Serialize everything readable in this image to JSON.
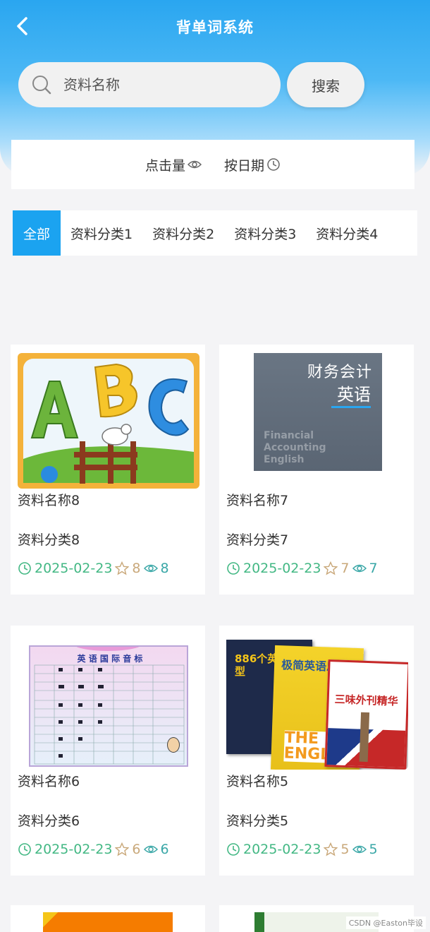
{
  "header": {
    "title": "背单词系统"
  },
  "search": {
    "placeholder": "资料名称",
    "button_label": "搜索"
  },
  "sort": {
    "by_clicks": "点击量",
    "by_date": "按日期"
  },
  "tabs": [
    {
      "label": "全部",
      "active": true
    },
    {
      "label": "资料分类1"
    },
    {
      "label": "资料分类2"
    },
    {
      "label": "资料分类3"
    },
    {
      "label": "资料分类4"
    }
  ],
  "items": [
    {
      "name": "资料名称8",
      "category": "资料分类8",
      "date": "2025-02-23",
      "likes": "8",
      "views": "8",
      "image": "abc-letters"
    },
    {
      "name": "资料名称7",
      "category": "资料分类7",
      "date": "2025-02-23",
      "likes": "7",
      "views": "7",
      "image": "book-cover",
      "cover_text": {
        "title_cn": "财务会计",
        "subtitle_cn": "英语",
        "title_en": "Financial Accounting English"
      }
    },
    {
      "name": "资料名称6",
      "category": "资料分类6",
      "date": "2025-02-23",
      "likes": "6",
      "views": "6",
      "image": "phonetic-chart",
      "cover_text": {
        "title_cn": "英 语 国 际 音 标"
      }
    },
    {
      "name": "资料名称5",
      "category": "资料分类5",
      "date": "2025-02-23",
      "likes": "5",
      "views": "5",
      "image": "book-stack",
      "cover_text": {
        "book1": "886个英语句型",
        "book2": "极简英语思维",
        "book3": "三味外刊精华",
        "eng": "THE ENGLISH"
      }
    }
  ],
  "watermark": "CSDN @Easton毕设",
  "colors": {
    "primary": "#1ba3f0",
    "date": "#43b884",
    "likes": "#c9a87a",
    "views": "#3aa7a7"
  }
}
